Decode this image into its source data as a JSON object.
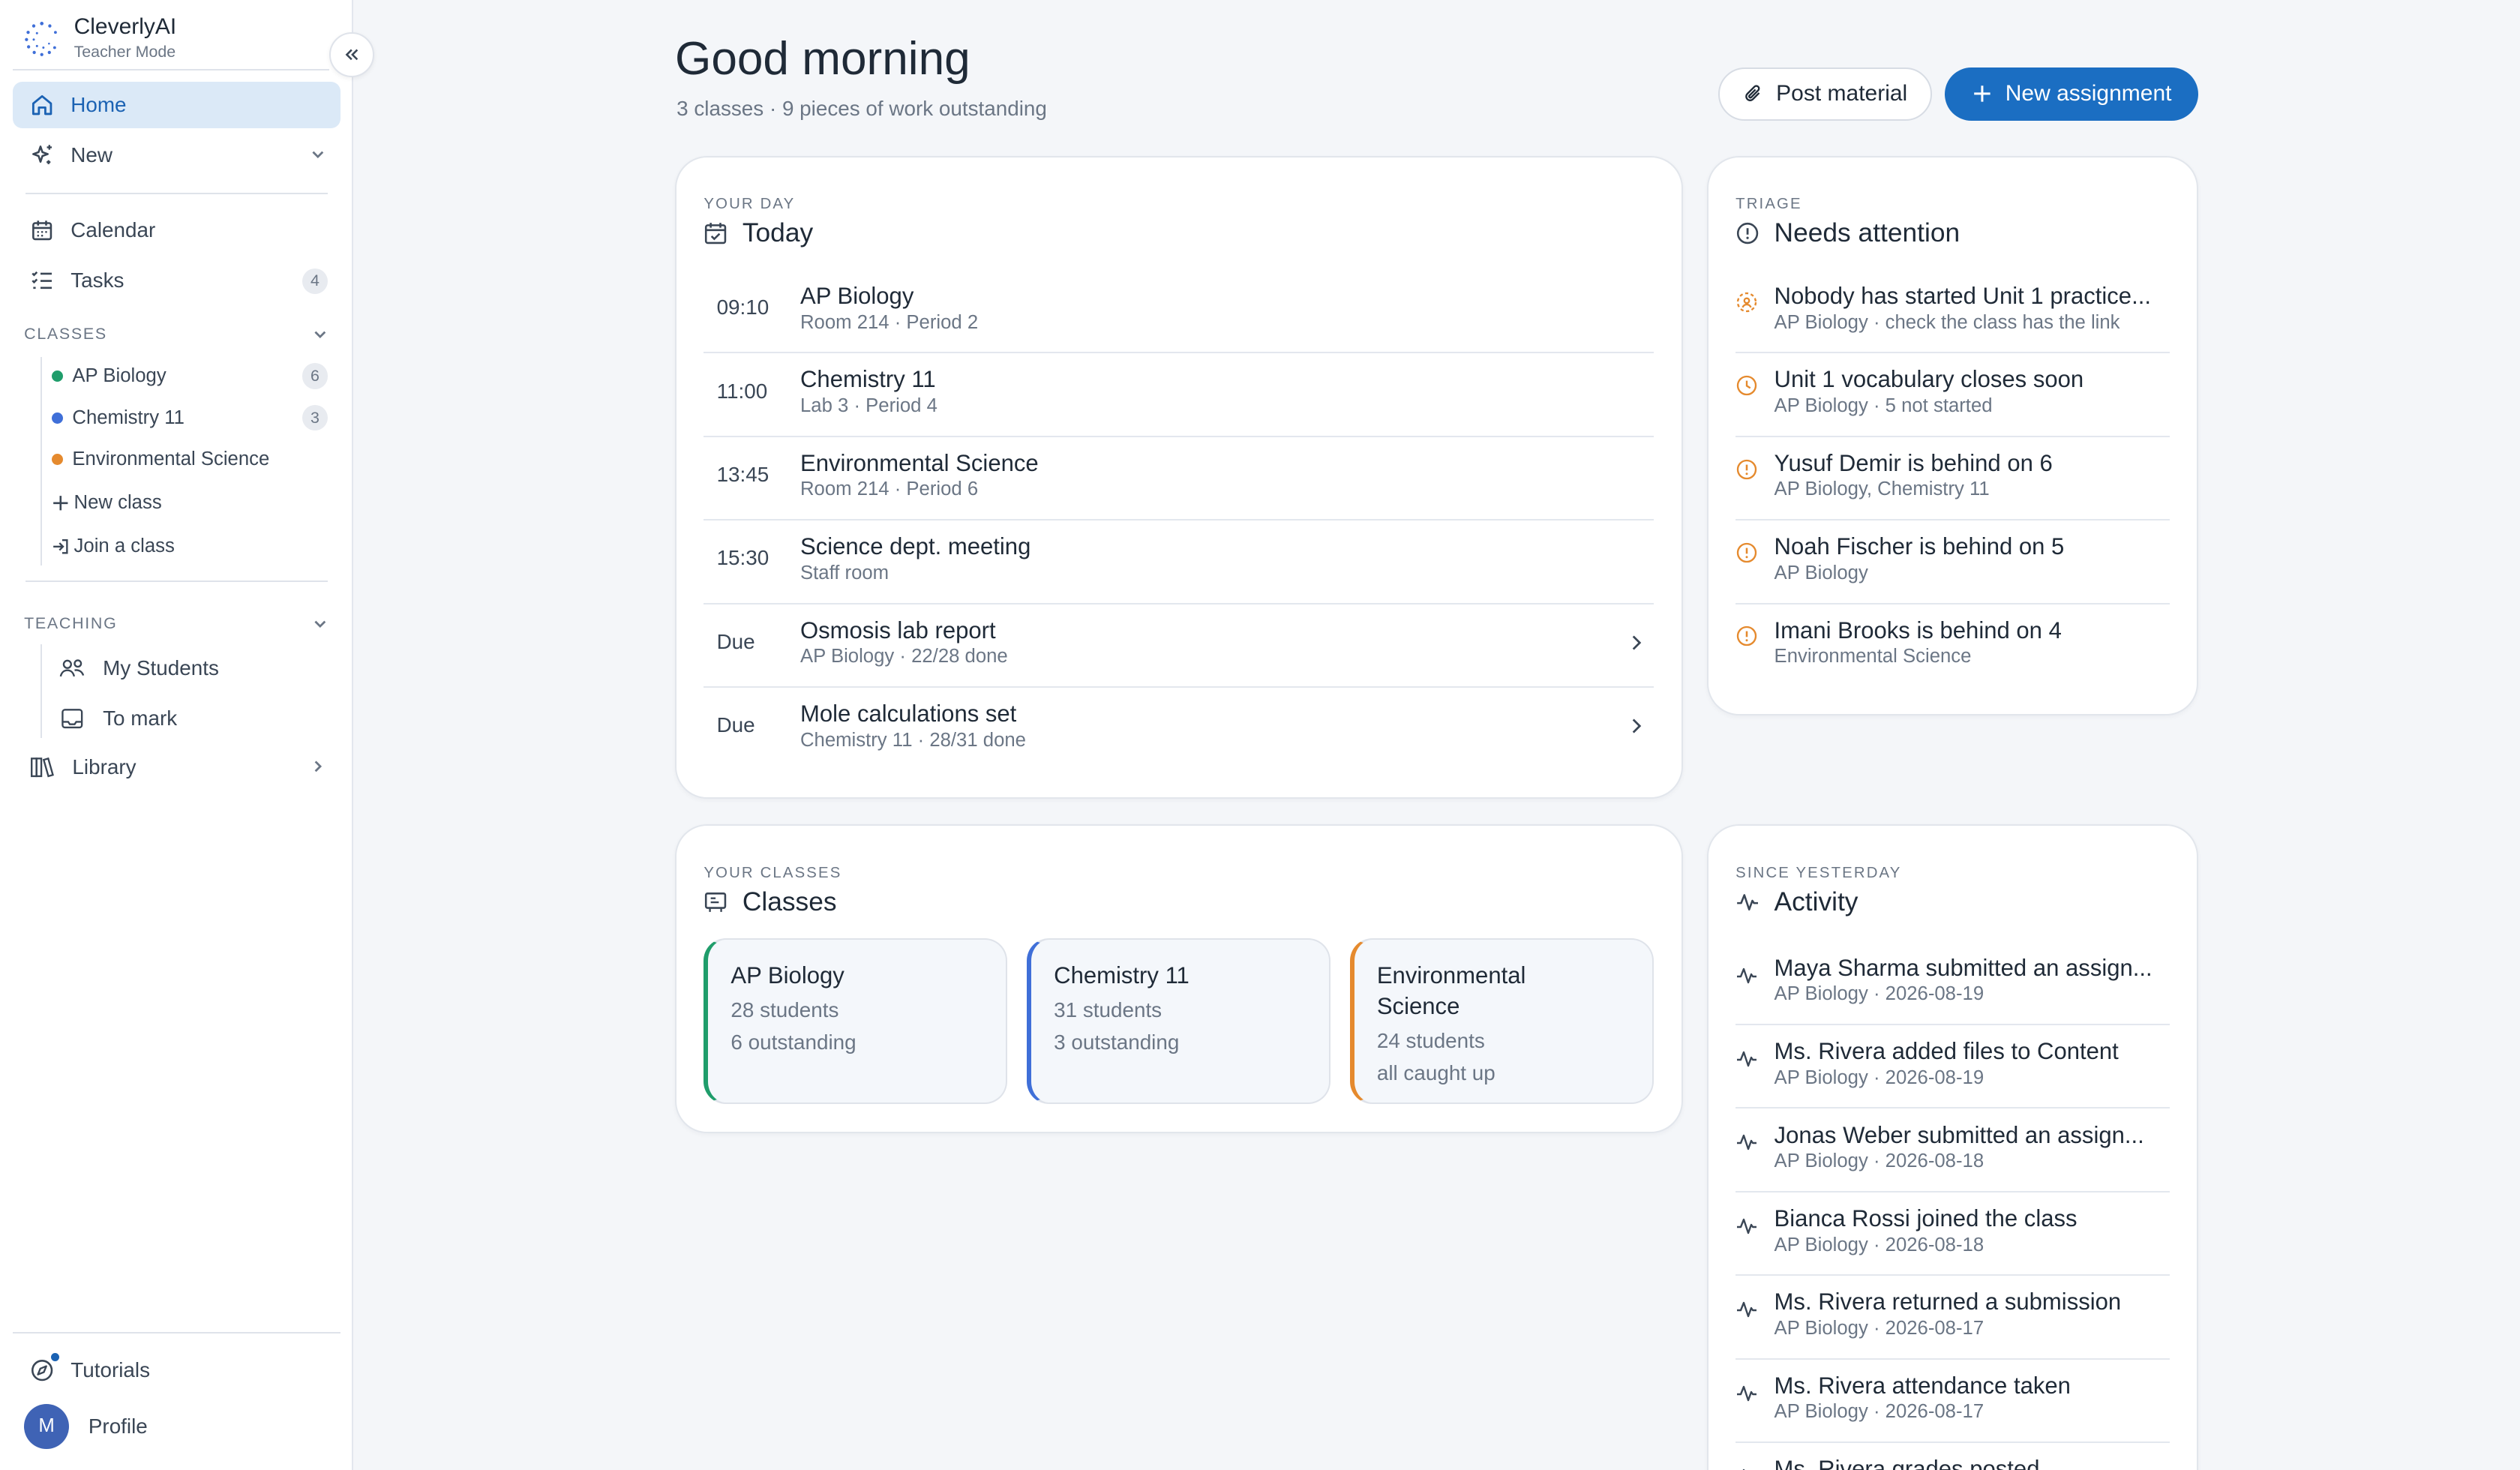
{
  "brand": {
    "name": "CleverlyAI",
    "mode": "Teacher Mode"
  },
  "nav": {
    "home": "Home",
    "new": "New",
    "calendar": "Calendar",
    "tasks": "Tasks",
    "tasks_badge": "4"
  },
  "classes_section": {
    "heading": "CLASSES",
    "items": [
      {
        "label": "AP Biology",
        "badge": "6",
        "color": "#1f9d6b"
      },
      {
        "label": "Chemistry 11",
        "badge": "3",
        "color": "#3f6fd8"
      },
      {
        "label": "Environmental Science",
        "badge": "",
        "color": "#e58a2e"
      }
    ],
    "new_class": "New class",
    "join_class": "Join a class"
  },
  "teaching_section": {
    "heading": "TEACHING",
    "my_students": "My Students",
    "to_mark": "To mark",
    "library": "Library"
  },
  "footer": {
    "tutorials": "Tutorials",
    "profile": "Profile",
    "avatar_initial": "M"
  },
  "header": {
    "greeting": "Good morning",
    "subtitle": "3 classes · 9 pieces of work outstanding",
    "post_material": "Post material",
    "new_assignment": "New assignment"
  },
  "today": {
    "eyebrow": "YOUR DAY",
    "title": "Today",
    "rows": [
      {
        "time": "09:10",
        "title": "AP Biology",
        "meta": "Room 214 · Period 2"
      },
      {
        "time": "11:00",
        "title": "Chemistry 11",
        "meta": "Lab 3 · Period 4"
      },
      {
        "time": "13:45",
        "title": "Environmental Science",
        "meta": "Room 214 · Period 6"
      },
      {
        "time": "15:30",
        "title": "Science dept. meeting",
        "meta": "Staff room"
      },
      {
        "time": "Due",
        "title": "Osmosis lab report",
        "meta": "AP Biology · 22/28 done"
      },
      {
        "time": "Due",
        "title": "Mole calculations set",
        "meta": "Chemistry 11 · 28/31 done"
      }
    ]
  },
  "triage": {
    "eyebrow": "TRIAGE",
    "title": "Needs attention",
    "rows": [
      {
        "title": "Nobody has started Unit 1 practice...",
        "meta": "AP Biology · check the class has the link",
        "icon": "users-alert-icon"
      },
      {
        "title": "Unit 1 vocabulary closes soon",
        "meta": "AP Biology · 5 not started",
        "icon": "clock-icon"
      },
      {
        "title": "Yusuf Demir is behind on 6",
        "meta": "AP Biology, Chemistry 11",
        "icon": "alert-circle-icon"
      },
      {
        "title": "Noah Fischer is behind on 5",
        "meta": "AP Biology",
        "icon": "alert-circle-icon"
      },
      {
        "title": "Imani Brooks is behind on 4",
        "meta": "Environmental Science",
        "icon": "alert-circle-icon"
      }
    ]
  },
  "classes_card": {
    "eyebrow": "YOUR CLASSES",
    "title": "Classes",
    "cards": [
      {
        "name": "AP Biology",
        "students": "28 students",
        "status": "6 outstanding",
        "color": "#1f9d6b"
      },
      {
        "name": "Chemistry 11",
        "students": "31 students",
        "status": "3 outstanding",
        "color": "#3f6fd8"
      },
      {
        "name": "Environmental Science",
        "students": "24 students",
        "status": "all caught up",
        "color": "#e58a2e"
      }
    ]
  },
  "activity": {
    "eyebrow": "SINCE YESTERDAY",
    "title": "Activity",
    "rows": [
      {
        "title": "Maya Sharma submitted an assign...",
        "meta": "AP Biology · 2026-08-19"
      },
      {
        "title": "Ms. Rivera added files to Content",
        "meta": "AP Biology · 2026-08-19"
      },
      {
        "title": "Jonas Weber submitted an assign...",
        "meta": "AP Biology · 2026-08-18"
      },
      {
        "title": "Bianca Rossi joined the class",
        "meta": "AP Biology · 2026-08-18"
      },
      {
        "title": "Ms. Rivera returned a submission",
        "meta": "AP Biology · 2026-08-17"
      },
      {
        "title": "Ms. Rivera attendance taken",
        "meta": "AP Biology · 2026-08-17"
      },
      {
        "title": "Ms. Rivera grades posted",
        "meta": ""
      }
    ]
  },
  "colors": {
    "accent": "#1b6ec2",
    "active_bg": "#dbe9f7",
    "warning": "#e58a2e"
  }
}
